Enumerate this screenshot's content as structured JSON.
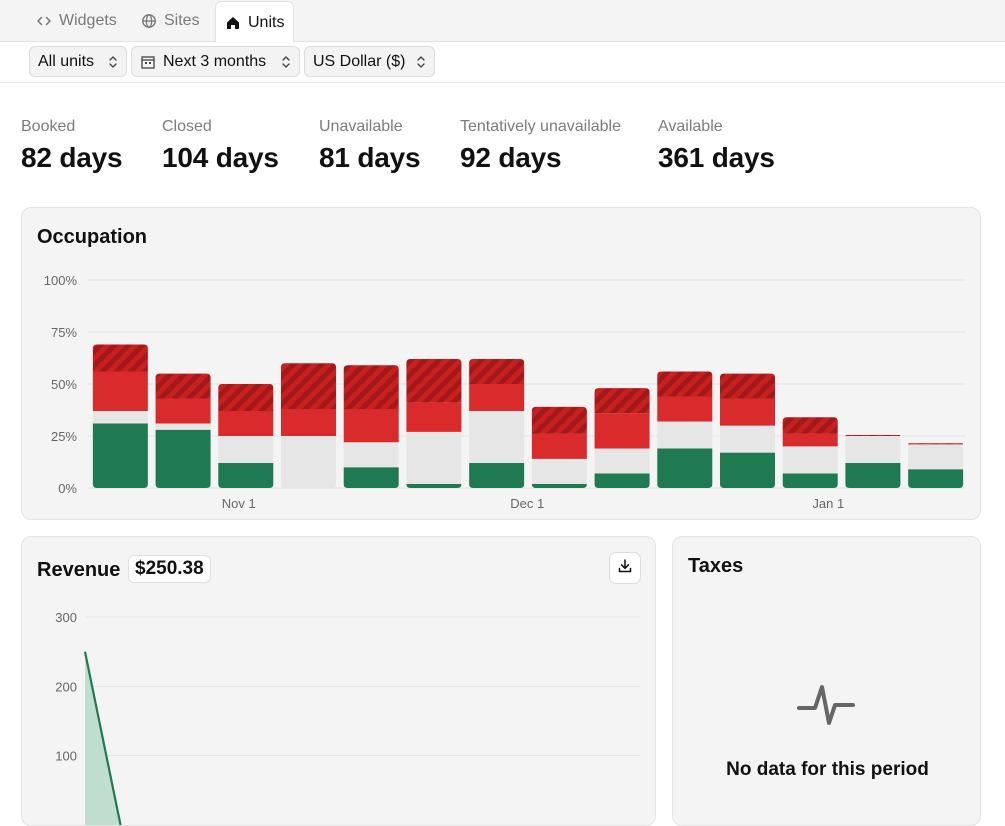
{
  "tabs": [
    {
      "label": "Widgets",
      "icon": "code-icon"
    },
    {
      "label": "Sites",
      "icon": "globe-icon"
    },
    {
      "label": "Units",
      "icon": "home-icon",
      "active": true
    }
  ],
  "filters": {
    "units": "All units",
    "range": "Next 3 months",
    "currency": "US Dollar ($)"
  },
  "stats": [
    {
      "label": "Booked",
      "value": "82 days"
    },
    {
      "label": "Closed",
      "value": "104 days"
    },
    {
      "label": "Unavailable",
      "value": "81 days"
    },
    {
      "label": "Tentatively unavailable",
      "value": "92 days"
    },
    {
      "label": "Available",
      "value": "361 days"
    }
  ],
  "colors": {
    "booked": "#1f7a52",
    "available": "#e6e6e6",
    "unavailable": "#d92b2b",
    "tentative_hatch_a": "#c11f1f",
    "tentative_hatch_b": "#a71a1a",
    "revenue_line": "#1f7a52",
    "revenue_fill": "#b9dccb"
  },
  "occupation": {
    "title": "Occupation",
    "chart_data": {
      "type": "bar",
      "stacked": true,
      "title": "Occupation",
      "yticks": [
        "0%",
        "25%",
        "50%",
        "75%",
        "100%"
      ],
      "ylim": [
        0,
        100
      ],
      "xticks": [
        {
          "label": "Nov 1",
          "after_bar": 2
        },
        {
          "label": "Dec 1",
          "after_bar": 6.6
        },
        {
          "label": "Jan 1",
          "after_bar": 11.4
        }
      ],
      "grid": true,
      "series_order": [
        "booked",
        "available",
        "unavailable",
        "tentative"
      ],
      "bars": [
        {
          "booked": 31,
          "available": 6,
          "unavailable": 19,
          "tentative": 13
        },
        {
          "booked": 28,
          "available": 3,
          "unavailable": 12,
          "tentative": 12
        },
        {
          "booked": 12,
          "available": 13,
          "unavailable": 12,
          "tentative": 13
        },
        {
          "booked": 0,
          "available": 25,
          "unavailable": 13,
          "tentative": 22
        },
        {
          "booked": 10,
          "available": 12,
          "unavailable": 16,
          "tentative": 21
        },
        {
          "booked": 2,
          "available": 25,
          "unavailable": 14,
          "tentative": 21
        },
        {
          "booked": 12,
          "available": 25,
          "unavailable": 13,
          "tentative": 12
        },
        {
          "booked": 2,
          "available": 12,
          "unavailable": 12,
          "tentative": 13
        },
        {
          "booked": 7,
          "available": 12,
          "unavailable": 17,
          "tentative": 12
        },
        {
          "booked": 19,
          "available": 13,
          "unavailable": 12,
          "tentative": 12
        },
        {
          "booked": 17,
          "available": 13,
          "unavailable": 13,
          "tentative": 12
        },
        {
          "booked": 7,
          "available": 13,
          "unavailable": 6,
          "tentative": 8
        },
        {
          "booked": 12,
          "available": 13,
          "unavailable": 0,
          "tentative": 0.5
        },
        {
          "booked": 9,
          "available": 12,
          "unavailable": 0,
          "tentative": 0.5
        }
      ]
    }
  },
  "revenue": {
    "title": "Revenue",
    "amount": "$250.38",
    "chart_data": {
      "type": "area",
      "yticks": [
        "100",
        "200",
        "300"
      ],
      "ylim": [
        0,
        300
      ],
      "x": [
        0,
        1,
        2
      ],
      "values": [
        250,
        0,
        0
      ],
      "grid": true
    }
  },
  "taxes": {
    "title": "Taxes",
    "empty_message": "No data for this period",
    "empty_icon": "pulse-icon"
  }
}
